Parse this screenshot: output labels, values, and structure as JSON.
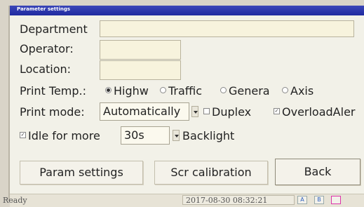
{
  "window": {
    "title": "Parameter settings"
  },
  "fields": {
    "department_label": "Department",
    "operator_label": "Operator:",
    "location_label": "Location:"
  },
  "print_temp": {
    "label": "Print Temp.:",
    "options": [
      "Highw",
      "Traffic",
      "Genera",
      "Axis"
    ],
    "selected": "Highw"
  },
  "print_mode": {
    "label": "Print mode:",
    "value": "Automatically",
    "duplex_label": "Duplex",
    "overload_label": "OverloadAler"
  },
  "idle": {
    "label": "Idle for more",
    "value": "30s",
    "backlight_label": "Backlight"
  },
  "buttons": {
    "param_settings": "Param settings",
    "scr_calibration": "Scr calibration",
    "back": "Back"
  },
  "statusbar": {
    "status": "Ready",
    "datetime": "2017-08-30 08:32:21",
    "tray_a": "A",
    "tray_b": "B"
  }
}
